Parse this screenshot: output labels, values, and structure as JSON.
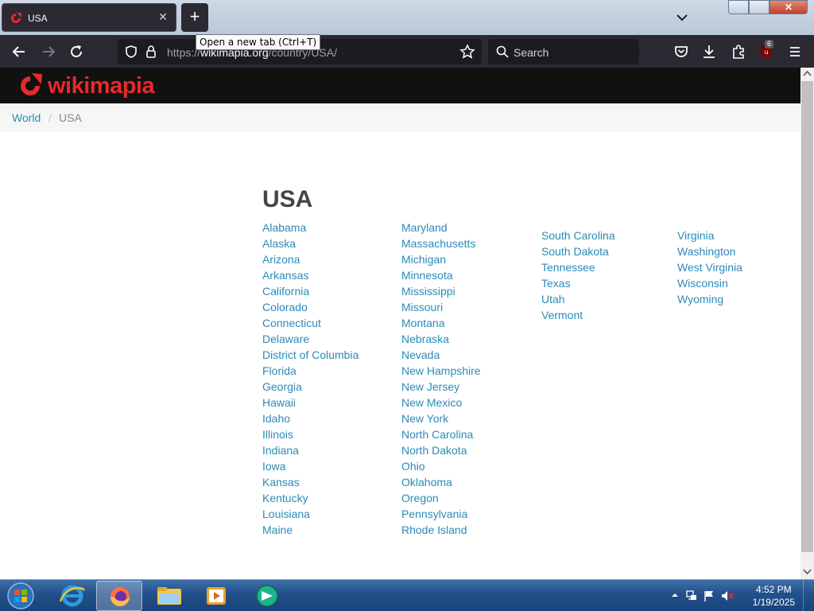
{
  "browser": {
    "tab": {
      "title": "USA",
      "close_glyph": "✕"
    },
    "new_tab_glyph": "+",
    "tooltip": "Open a new tab (Ctrl+T)",
    "url": {
      "prefix": "https://",
      "domain": "wikimapia.org",
      "path": "/country/USA/"
    },
    "search_placeholder": "Search",
    "extension_badge": "6",
    "window_controls": {
      "close_glyph": "✕"
    }
  },
  "site": {
    "logo_text": "wikimapia",
    "brand_color": "#e8282b",
    "link_color": "#2b8ab8",
    "breadcrumb": {
      "root": "World",
      "separator": "/",
      "current": "USA"
    }
  },
  "page": {
    "title": "USA",
    "states": {
      "col1": [
        "Alabama",
        "Alaska",
        "Arizona",
        "Arkansas",
        "California",
        "Colorado",
        "Connecticut",
        "Delaware",
        "District of Columbia",
        "Florida",
        "Georgia",
        "Hawaii",
        "Idaho",
        "Illinois",
        "Indiana",
        "Iowa",
        "Kansas",
        "Kentucky",
        "Louisiana",
        "Maine"
      ],
      "col2": [
        "Maryland",
        "Massachusetts",
        "Michigan",
        "Minnesota",
        "Mississippi",
        "Missouri",
        "Montana",
        "Nebraska",
        "Nevada",
        "New Hampshire",
        "New Jersey",
        "New Mexico",
        "New York",
        "North Carolina",
        "North Dakota",
        "Ohio",
        "Oklahoma",
        "Oregon",
        "Pennsylvania",
        "Rhode Island"
      ],
      "col3": [
        "South Carolina",
        "South Dakota",
        "Tennessee",
        "Texas",
        "Utah",
        "Vermont"
      ],
      "col4": [
        "Virginia",
        "Washington",
        "West Virginia",
        "Wisconsin",
        "Wyoming"
      ]
    }
  },
  "taskbar": {
    "clock": {
      "time": "4:52 PM",
      "date": "1/19/2025"
    },
    "apps": [
      "internet-explorer-icon",
      "firefox-icon",
      "file-explorer-icon",
      "media-player-icon",
      "app-icon"
    ]
  }
}
